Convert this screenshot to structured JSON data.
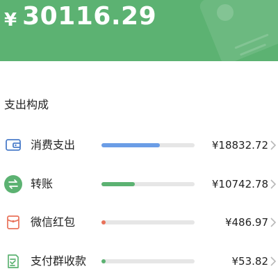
{
  "header": {
    "currency": "¥",
    "total": "30116.29",
    "color": "#5cb272"
  },
  "section": {
    "title": "支出构成"
  },
  "items": [
    {
      "label": "消费支出",
      "amount": "¥18832.72",
      "share": 0.625,
      "bar_color": "#6b9de6",
      "icon": "wallet-icon",
      "icon_color": "#4a7cc9"
    },
    {
      "label": "转账",
      "amount": "¥10742.78",
      "share": 0.357,
      "bar_color": "#5cb272",
      "icon": "transfer-icon",
      "icon_color": "#5cb272"
    },
    {
      "label": "微信红包",
      "amount": "¥486.97",
      "share": 0.016,
      "bar_color": "#e9725a",
      "icon": "red-packet-icon",
      "icon_color": "#e9725a"
    },
    {
      "label": "支付群收款",
      "amount": "¥53.82",
      "share": 0.002,
      "bar_color": "#5cb272",
      "icon": "group-collection-icon",
      "icon_color": "#5cb272"
    }
  ]
}
